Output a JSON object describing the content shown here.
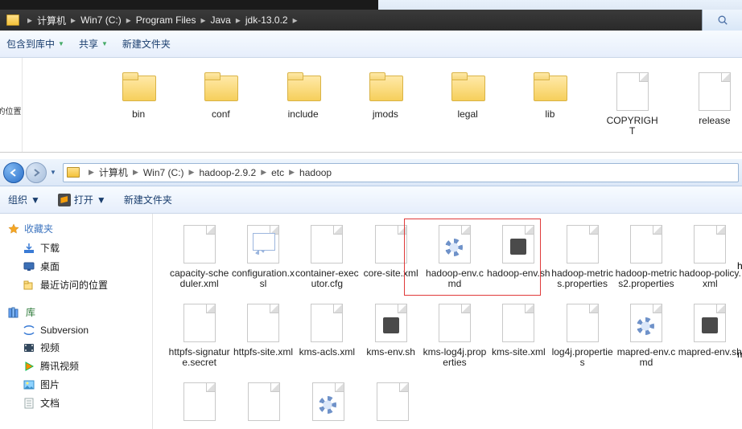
{
  "top": {
    "breadcrumb": [
      "计算机",
      "Win7 (C:)",
      "Program Files",
      "Java",
      "jdk-13.0.2"
    ],
    "toolbar": {
      "include": "包含到库中",
      "share": "共享",
      "newfolder": "新建文件夹"
    },
    "sidebar_hint": "访问的位置",
    "items": [
      {
        "label": "bin",
        "type": "folder"
      },
      {
        "label": "conf",
        "type": "folder"
      },
      {
        "label": "include",
        "type": "folder"
      },
      {
        "label": "jmods",
        "type": "folder"
      },
      {
        "label": "legal",
        "type": "folder"
      },
      {
        "label": "lib",
        "type": "folder"
      },
      {
        "label": "COPYRIGHT",
        "type": "doc"
      },
      {
        "label": "release",
        "type": "doc"
      }
    ]
  },
  "bot": {
    "breadcrumb": [
      "计算机",
      "Win7 (C:)",
      "hadoop-2.9.2",
      "etc",
      "hadoop"
    ],
    "toolbar": {
      "organize": "组织",
      "open": "打开",
      "newfolder": "新建文件夹"
    },
    "nav": {
      "fav": "收藏夹",
      "download": "下载",
      "desktop": "桌面",
      "recent": "最近访问的位置",
      "lib": "库",
      "subversion": "Subversion",
      "video": "视频",
      "tencent": "腾讯视频",
      "pictures": "图片",
      "docs": "文档"
    },
    "row1": [
      {
        "label": "capacity-scheduler.xml",
        "icon": "doc"
      },
      {
        "label": "configuration.xsl",
        "icon": "cfg"
      },
      {
        "label": "container-executor.cfg",
        "icon": "doc"
      },
      {
        "label": "core-site.xml",
        "icon": "doc"
      },
      {
        "label": "hadoop-env.cmd",
        "icon": "gear"
      },
      {
        "label": "hadoop-env.sh",
        "icon": "subl"
      },
      {
        "label": "hadoop-metrics.properties",
        "icon": "doc"
      },
      {
        "label": "hadoop-metrics2.properties",
        "icon": "doc"
      },
      {
        "label": "hadoop-policy.xml",
        "icon": "doc"
      }
    ],
    "row2": [
      {
        "label": "httpfs-signature.secret",
        "icon": "doc"
      },
      {
        "label": "httpfs-site.xml",
        "icon": "doc"
      },
      {
        "label": "kms-acls.xml",
        "icon": "doc"
      },
      {
        "label": "kms-env.sh",
        "icon": "subl"
      },
      {
        "label": "kms-log4j.properties",
        "icon": "doc"
      },
      {
        "label": "kms-site.xml",
        "icon": "doc"
      },
      {
        "label": "log4j.properties",
        "icon": "doc"
      },
      {
        "label": "mapred-env.cmd",
        "icon": "gear"
      },
      {
        "label": "mapred-env.sh",
        "icon": "subl"
      }
    ],
    "row1_cut": "hi",
    "row2_cut": "m"
  }
}
